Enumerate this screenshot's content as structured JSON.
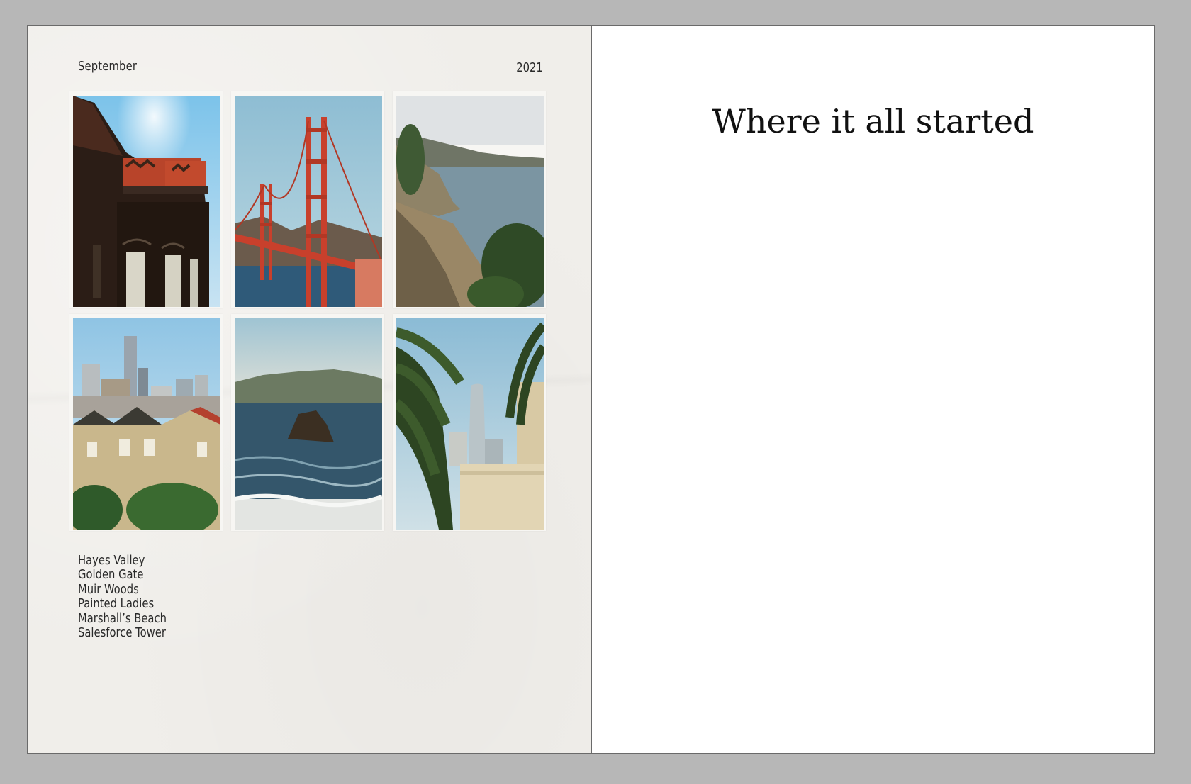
{
  "left_page": {
    "month": "September",
    "year": "2021",
    "photos": [
      {
        "subject": "Victorian house facade",
        "icon": "victorian-house-photo"
      },
      {
        "subject": "Golden Gate Bridge",
        "icon": "golden-gate-bridge-photo"
      },
      {
        "subject": "Coastal cliffs",
        "icon": "coastal-cliffs-photo"
      },
      {
        "subject": "Painted Ladies with skyline",
        "icon": "painted-ladies-photo"
      },
      {
        "subject": "Ocean rock at beach",
        "icon": "beach-rock-photo"
      },
      {
        "subject": "Palm trees and tower",
        "icon": "salesforce-tower-photo"
      }
    ],
    "captions": [
      "Hayes Valley",
      "Golden Gate",
      "Muir Woods",
      "Painted Ladies",
      "Marshall’s Beach",
      "Salesforce Tower"
    ]
  },
  "right_page": {
    "heading": "Where it all started"
  },
  "colors": {
    "workspace_bg": "#b7b7b7",
    "left_paper": "#f0eeea",
    "right_paper": "#ffffff",
    "bridge_red": "#c8402c"
  }
}
